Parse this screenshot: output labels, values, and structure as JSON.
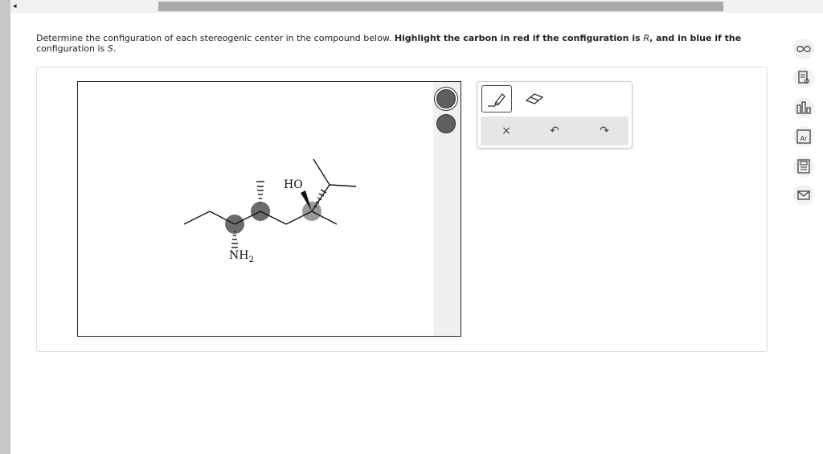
{
  "nav": {
    "back_glyph": "◂"
  },
  "question": {
    "prompt_part1": "Determine the configuration of each stereogenic center in the compound below. ",
    "prompt_bold": "Highlight the carbon in red if the configuration is ",
    "prompt_r": "R",
    "prompt_bold2": ", and in blue if the",
    "prompt_part2": "configuration is ",
    "prompt_s": "S",
    "prompt_end": "."
  },
  "molecule": {
    "label_ho": "HO",
    "label_nh": "NH",
    "label_nh_sub": "2"
  },
  "palette": {
    "swatch_colors": [
      "#5f5f5f",
      "#5f5f5f"
    ],
    "selected_index": 0
  },
  "toolbox": {
    "tools": [
      "highlighter-icon",
      "eraser-icon"
    ],
    "actions": {
      "clear_glyph": "×",
      "undo_glyph": "↶",
      "redo_glyph": "↷"
    }
  },
  "sidebar": {
    "icons": [
      "infinity-icon",
      "notes-icon",
      "chart-icon",
      "periodic-table-icon",
      "calculator-icon",
      "mail-icon"
    ],
    "periodic_label": "Ar"
  },
  "colors": {
    "highlight_gray": "#6b6b6b",
    "highlight_light": "#9a9a9a",
    "stroke": "#111111"
  }
}
